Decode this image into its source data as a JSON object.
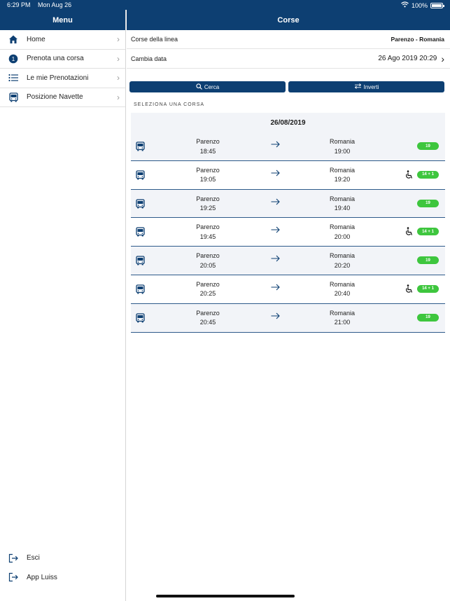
{
  "status": {
    "time": "6:29 PM",
    "date": "Mon Aug 26",
    "battery": "100%"
  },
  "sidebar": {
    "title": "Menu",
    "items": [
      {
        "label": "Home",
        "icon": "home-icon"
      },
      {
        "label": "Prenota una corsa",
        "icon": "step-one-icon"
      },
      {
        "label": "Le mie Prenotazioni",
        "icon": "list-icon"
      },
      {
        "label": "Posizione Navette",
        "icon": "bus-icon"
      }
    ],
    "bottom_items": [
      {
        "label": "Esci",
        "icon": "logout-icon"
      },
      {
        "label": "App Luiss",
        "icon": "logout-icon"
      }
    ],
    "step_number": "1"
  },
  "main": {
    "title": "Corse",
    "line_label": "Corse della linea",
    "line_value": "Parenzo - Romania",
    "date_label": "Cambia data",
    "date_value": "26 Ago 2019 20:29",
    "search_label": "Cerca",
    "invert_label": "Inverti",
    "section_title": "SELEZIONA UNA CORSA",
    "trip_date": "26/08/2019",
    "trips": [
      {
        "from": "Parenzo",
        "dep": "18:45",
        "to": "Romania",
        "arr": "19:00",
        "seats": "19",
        "wheelchair": false
      },
      {
        "from": "Parenzo",
        "dep": "19:05",
        "to": "Romania",
        "arr": "19:20",
        "seats": "14 + 1",
        "wheelchair": true
      },
      {
        "from": "Parenzo",
        "dep": "19:25",
        "to": "Romania",
        "arr": "19:40",
        "seats": "19",
        "wheelchair": false
      },
      {
        "from": "Parenzo",
        "dep": "19:45",
        "to": "Romania",
        "arr": "20:00",
        "seats": "14 + 1",
        "wheelchair": true
      },
      {
        "from": "Parenzo",
        "dep": "20:05",
        "to": "Romania",
        "arr": "20:20",
        "seats": "19",
        "wheelchair": false
      },
      {
        "from": "Parenzo",
        "dep": "20:25",
        "to": "Romania",
        "arr": "20:40",
        "seats": "14 + 1",
        "wheelchair": true
      },
      {
        "from": "Parenzo",
        "dep": "20:45",
        "to": "Romania",
        "arr": "21:00",
        "seats": "19",
        "wheelchair": false
      }
    ]
  },
  "colors": {
    "navy": "#0d3f72",
    "badge_green": "#3ec63e",
    "row_bg": "#f2f4f8"
  }
}
